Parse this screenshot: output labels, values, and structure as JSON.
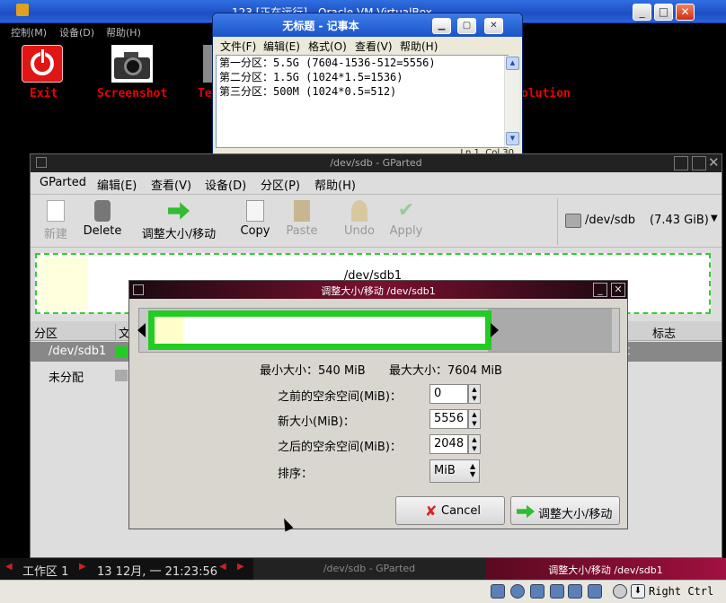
{
  "vbox": {
    "title": "123 [正在运行] - Oracle VM VirtualBox",
    "menu": [
      "控制(M)",
      "设备(D)",
      "帮助(H)"
    ],
    "host_key": "Right Ctrl"
  },
  "desktop": {
    "icons": [
      {
        "label": "Exit"
      },
      {
        "label": "Screenshot"
      },
      {
        "label": "Te"
      },
      {
        "label": "olution"
      }
    ]
  },
  "notepad": {
    "title": "无标题 - 记事本",
    "menu": [
      "文件(F)",
      "编辑(E)",
      "格式(O)",
      "查看(V)",
      "帮助(H)"
    ],
    "lines": [
      "第一分区：5.5G  (7604-1536-512=5556)",
      "第二分区：1.5G  (1024*1.5=1536)",
      "第三分区：500M  (1024*0.5=512)"
    ],
    "status": "Ln 1, Col 30"
  },
  "gparted": {
    "title": "/dev/sdb - GParted",
    "menu": [
      "GParted",
      "编辑(E)",
      "查看(V)",
      "设备(D)",
      "分区(P)",
      "帮助(H)"
    ],
    "toolbar": [
      "新建",
      "Delete",
      "调整大小/移动",
      "Copy",
      "Paste",
      "Undo",
      "Apply"
    ],
    "device": "/dev/sdb",
    "device_size": "(7.43 GiB)",
    "visual_label": "/dev/sdb1",
    "columns": [
      "分区",
      "文",
      "标志"
    ],
    "rows": [
      {
        "name": "/dev/sdb1",
        "extra": "t"
      },
      {
        "name": "未分配"
      }
    ]
  },
  "dialog": {
    "title": "调整大小/移动 /dev/sdb1",
    "min_size": "最小大小：540 MiB",
    "max_size": "最大大小：7604 MiB",
    "before_label": "之前的空余空间(MiB)：",
    "before_value": "0",
    "size_label": "新大小(MiB)：",
    "size_value": "5556",
    "after_label": "之后的空余空间(MiB)：",
    "after_value": "2048",
    "align_label": "排序：",
    "align_value": "MiB",
    "cancel": "Cancel",
    "resize": "调整大小/移动"
  },
  "taskbar": {
    "workspace": "工作区 1",
    "datetime": "13 12月, 一 21:23:56",
    "task1": "/dev/sdb - GParted",
    "task2": "调整大小/移动 /dev/sdb1"
  }
}
